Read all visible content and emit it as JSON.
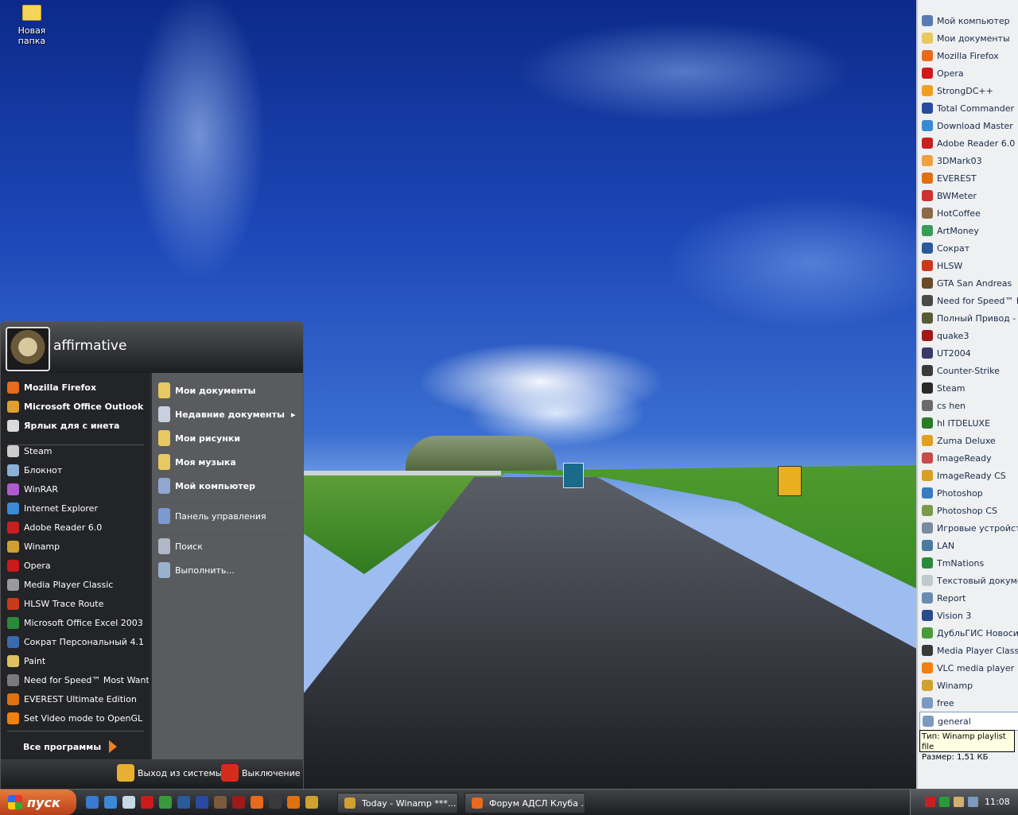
{
  "desktop": {
    "folder_label": "Новая папка"
  },
  "quicklaunch_panel": {
    "items": [
      {
        "label": "Мой компьютер",
        "icon": "computer-icon",
        "color": "#5a7ab0"
      },
      {
        "label": "Мои документы",
        "icon": "documents-icon",
        "color": "#e8c860"
      },
      {
        "label": "Mozilla Firefox",
        "icon": "firefox-icon",
        "color": "#e86a1a"
      },
      {
        "label": "Opera",
        "icon": "opera-icon",
        "color": "#cc1a1a"
      },
      {
        "label": "StrongDC++",
        "icon": "strongdc-icon",
        "color": "#f0a020"
      },
      {
        "label": "Total Commander",
        "icon": "floppy-icon",
        "color": "#2a4aa0"
      },
      {
        "label": "Download Master",
        "icon": "download-icon",
        "color": "#3a8ad0"
      },
      {
        "label": "Adobe Reader 6.0",
        "icon": "pdf-icon",
        "color": "#c82020"
      },
      {
        "label": "3DMark03",
        "icon": "3dmark-icon",
        "color": "#f0a040"
      },
      {
        "label": "EVEREST",
        "icon": "info-icon",
        "color": "#e07010"
      },
      {
        "label": "BWMeter",
        "icon": "bwmeter-icon",
        "color": "#d03030"
      },
      {
        "label": "HotCoffee",
        "icon": "coffee-icon",
        "color": "#8a6a4a"
      },
      {
        "label": "ArtMoney",
        "icon": "artmoney-icon",
        "color": "#3a9a5a"
      },
      {
        "label": "Сократ",
        "icon": "socrat-icon",
        "color": "#2a5a9a"
      },
      {
        "label": "HLSW",
        "icon": "hlsw-icon",
        "color": "#c83a1a"
      },
      {
        "label": "GTA San Andreas",
        "icon": "gta-icon",
        "color": "#6a4a2a"
      },
      {
        "label": "Need for Speed™ Mc",
        "icon": "nfs-icon",
        "color": "#4a4a4a"
      },
      {
        "label": "Полный Привод - УА",
        "icon": "offroad-icon",
        "color": "#5a5a3a"
      },
      {
        "label": "quake3",
        "icon": "quake-icon",
        "color": "#a01a1a"
      },
      {
        "label": "UT2004",
        "icon": "ut-icon",
        "color": "#3a3a6a"
      },
      {
        "label": "Counter-Strike",
        "icon": "cs-icon",
        "color": "#3a3a3a"
      },
      {
        "label": "Steam",
        "icon": "steam-icon",
        "color": "#2a2a2a"
      },
      {
        "label": "cs hen",
        "icon": "shortcut-icon",
        "color": "#6a6a6a"
      },
      {
        "label": "hl ITDELUXE",
        "icon": "hl-icon",
        "color": "#2a7a2a"
      },
      {
        "label": "Zuma Deluxe",
        "icon": "zuma-icon",
        "color": "#e0a020"
      },
      {
        "label": "ImageReady",
        "icon": "imageready-icon",
        "color": "#c84a4a"
      },
      {
        "label": "ImageReady CS",
        "icon": "imageready-cs-icon",
        "color": "#d8a020"
      },
      {
        "label": "Photoshop",
        "icon": "photoshop-icon",
        "color": "#3a7ac0"
      },
      {
        "label": "Photoshop CS",
        "icon": "photoshop-cs-icon",
        "color": "#7a9a4a"
      },
      {
        "label": "Игровые устройства",
        "icon": "gamepad-icon",
        "color": "#7a8aa0"
      },
      {
        "label": "LAN",
        "icon": "network-icon",
        "color": "#4a7aa0"
      },
      {
        "label": "TmNations",
        "icon": "tmnations-icon",
        "color": "#2a8a3a"
      },
      {
        "label": "Текстовый докумен",
        "icon": "text-document-icon",
        "color": "#c0c8d0"
      },
      {
        "label": "Report",
        "icon": "report-icon",
        "color": "#6a8ab0"
      },
      {
        "label": "Vision 3",
        "icon": "vision-icon",
        "color": "#2a4a8a"
      },
      {
        "label": "ДубльГИС Новосиби",
        "icon": "dublgis-icon",
        "color": "#4a9a3a"
      },
      {
        "label": "Media Player Classic",
        "icon": "mpc-icon",
        "color": "#3a3a3a"
      },
      {
        "label": "VLC media player",
        "icon": "vlc-icon",
        "color": "#f08010"
      },
      {
        "label": "Winamp",
        "icon": "winamp-icon",
        "color": "#d0a030"
      },
      {
        "label": "free",
        "icon": "playlist-icon",
        "color": "#7a9ac0"
      },
      {
        "label": "general",
        "icon": "playlist-icon",
        "color": "#7a9ac0",
        "selected": true
      }
    ],
    "tooltip": {
      "line1": "Тип: Winamp playlist file",
      "line2": "Размер: 1,51 КБ"
    }
  },
  "start_menu": {
    "username": "affirmative",
    "pinned": [
      {
        "label": "Mozilla Firefox",
        "icon": "firefox-icon",
        "color": "#e86a1a"
      },
      {
        "label": "Microsoft Office Outlook",
        "icon": "outlook-icon",
        "color": "#e0a030"
      },
      {
        "label": "Ярлык для с инета",
        "icon": "shortcut-icon",
        "color": "#dadada"
      }
    ],
    "recent": [
      {
        "label": "Steam",
        "icon": "steam-icon",
        "color": "#cccccc"
      },
      {
        "label": "Блокнот",
        "icon": "notepad-icon",
        "color": "#8ab0d8"
      },
      {
        "label": "WinRAR",
        "icon": "winrar-icon",
        "color": "#b05ad0"
      },
      {
        "label": "Internet Explorer",
        "icon": "ie-icon",
        "color": "#3a8ad8"
      },
      {
        "label": "Adobe Reader 6.0",
        "icon": "pdf-icon",
        "color": "#c82020"
      },
      {
        "label": "Winamp",
        "icon": "winamp-icon",
        "color": "#d0a030"
      },
      {
        "label": "Opera",
        "icon": "opera-icon",
        "color": "#cc1a1a"
      },
      {
        "label": "Media Player Classic",
        "icon": "mpc-icon",
        "color": "#9a9a9a"
      },
      {
        "label": "HLSW Trace Route",
        "icon": "hlsw-icon",
        "color": "#c83a1a"
      },
      {
        "label": "Microsoft Office Excel 2003",
        "icon": "excel-icon",
        "color": "#2a8a3a"
      },
      {
        "label": "Сократ Персональный 4.1",
        "icon": "socrat-icon",
        "color": "#3a6ab0"
      },
      {
        "label": "Paint",
        "icon": "paint-icon",
        "color": "#e0c060"
      },
      {
        "label": "Need for Speed™ Most Want...",
        "icon": "nfs-icon",
        "color": "#7a7a7a"
      },
      {
        "label": "EVEREST Ultimate Edition",
        "icon": "info-icon",
        "color": "#e07010"
      },
      {
        "label": "Set Video mode to OpenGL",
        "icon": "vlc-icon",
        "color": "#f08010"
      }
    ],
    "all_programs": "Все программы",
    "places": [
      {
        "label": "Мои документы",
        "icon": "documents-folder-icon",
        "color": "#e8c860"
      },
      {
        "label": "Недавние документы",
        "icon": "recent-docs-icon",
        "color": "#c8d0e0",
        "arrow": "▸"
      },
      {
        "label": "Мои рисунки",
        "icon": "pictures-folder-icon",
        "color": "#e8c860"
      },
      {
        "label": "Моя музыка",
        "icon": "music-folder-icon",
        "color": "#e8c860"
      },
      {
        "label": "Мой компьютер",
        "icon": "computer-icon",
        "color": "#90a8d0"
      }
    ],
    "system": [
      {
        "label": "Панель управления",
        "icon": "control-panel-icon",
        "color": "#7a9ad0"
      },
      {
        "label": "Поиск",
        "icon": "search-icon",
        "color": "#b0b8c8"
      },
      {
        "label": "Выполнить...",
        "icon": "run-icon",
        "color": "#9ab0d0"
      }
    ],
    "logoff": "Выход из системы",
    "shutdown": "Выключение"
  },
  "taskbar": {
    "start_label": "пуск",
    "tasks": [
      {
        "label": "Today - Winamp ***...",
        "icon": "winamp-icon",
        "color": "#d0a030"
      },
      {
        "label": "Форум АДСЛ Клуба ...",
        "icon": "firefox-icon",
        "color": "#e86a1a"
      }
    ],
    "clock": "11:08"
  }
}
